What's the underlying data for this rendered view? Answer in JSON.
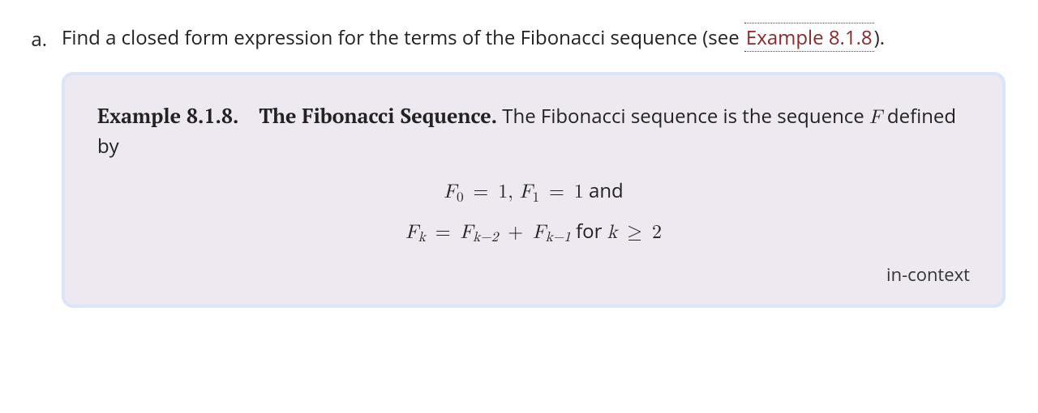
{
  "item": {
    "label": "a.",
    "prompt_pre": "Find a closed form expression for the terms of the Fibonacci sequence (see ",
    "link_text": "Example 8.1.8",
    "prompt_post": ")."
  },
  "example": {
    "heading": "Example 8.1.8.",
    "title": "The Fibonacci Sequence.",
    "intro_pre": " The Fibonacci sequence is the sequence ",
    "intro_var": "F",
    "intro_post": " defined by",
    "math1": {
      "F": "F",
      "sub0": "0",
      "eq": " = ",
      "one1": "1",
      "comma": ", ",
      "sub1": "1",
      "one2": "1",
      "and": " and"
    },
    "math2": {
      "F": "F",
      "subk": "k",
      "eq": " = ",
      "subkm2": "k−2",
      "plus": " + ",
      "subkm1": "k−1",
      "for": " for ",
      "k": "k",
      "ge": " ≥ ",
      "two": "2"
    },
    "in_context": "in-context"
  }
}
